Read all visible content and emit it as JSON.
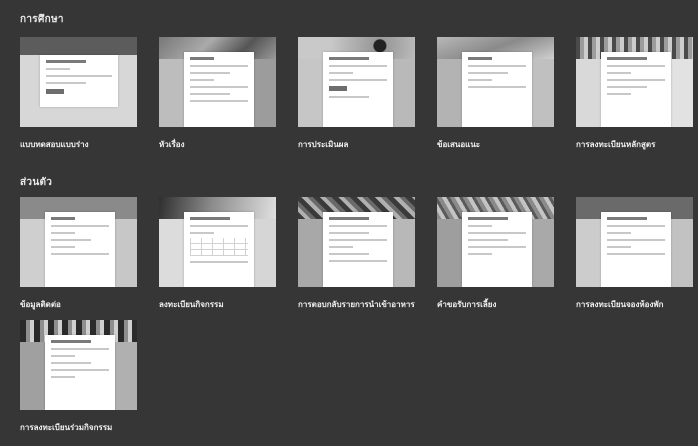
{
  "sections": [
    {
      "title": "การศึกษา",
      "cards": [
        {
          "label": "แบบทดสอบแบบร่าง"
        },
        {
          "label": "หัวเรื่อง"
        },
        {
          "label": "การประเมินผล"
        },
        {
          "label": "ข้อเสนอแนะ"
        },
        {
          "label": "การลงทะเบียนหลักสูตร"
        }
      ]
    },
    {
      "title": "ส่วนตัว",
      "cards": [
        {
          "label": "ข้อมูลติดต่อ"
        },
        {
          "label": "ลงทะเบียนกิจกรรม"
        },
        {
          "label": "การตอบกลับรายการนำเข้าอาหาร"
        },
        {
          "label": "คำขอรับการเลี้ยง"
        },
        {
          "label": "การลงทะเบียนจองห้องพัก"
        },
        {
          "label": "การลงทะเบียนร่วมกิจกรรม"
        }
      ]
    }
  ]
}
